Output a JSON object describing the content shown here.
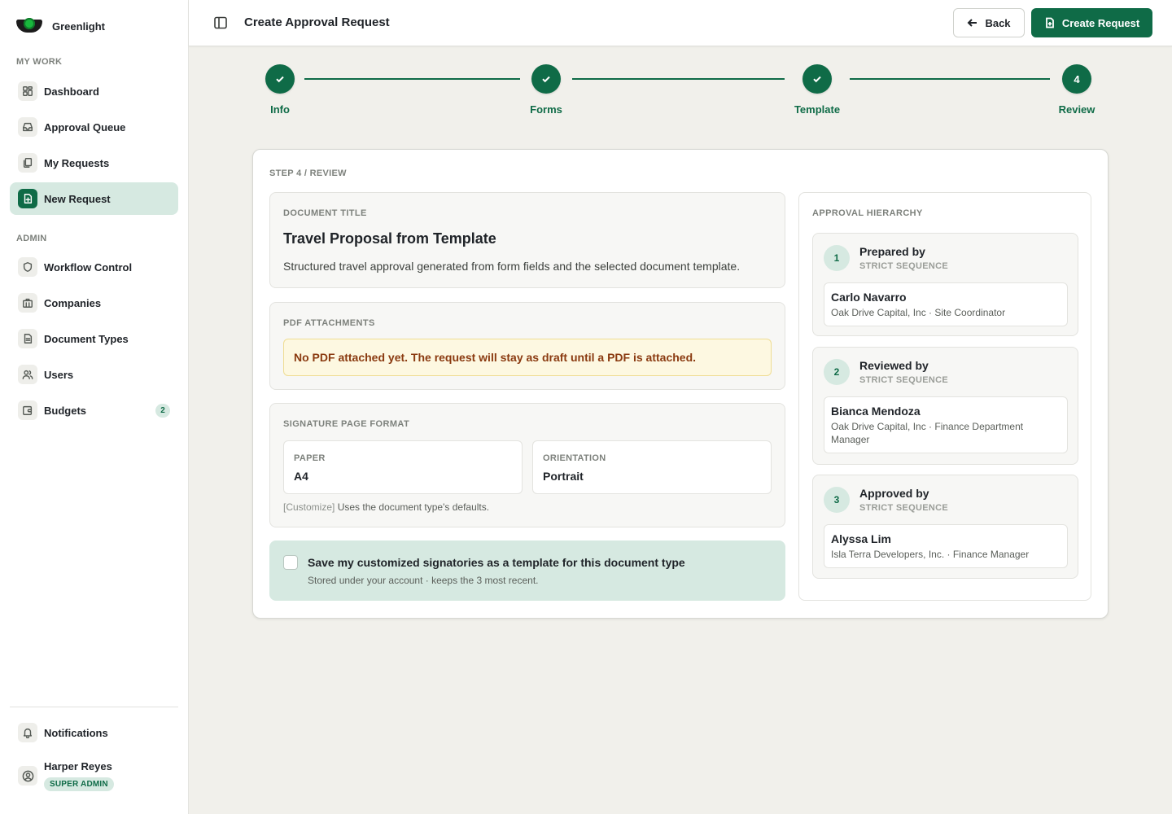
{
  "app": {
    "name": "Greenlight"
  },
  "sidebar": {
    "sections": [
      {
        "label": "MY WORK"
      },
      {
        "label": "ADMIN"
      }
    ],
    "my_work": [
      {
        "label": "Dashboard",
        "icon": "grid-icon"
      },
      {
        "label": "Approval Queue",
        "icon": "inbox-icon"
      },
      {
        "label": "My Requests",
        "icon": "files-icon"
      },
      {
        "label": "New Request",
        "icon": "file-plus-icon",
        "active": true
      }
    ],
    "admin": [
      {
        "label": "Workflow Control",
        "icon": "shield-icon"
      },
      {
        "label": "Companies",
        "icon": "building-icon"
      },
      {
        "label": "Document Types",
        "icon": "document-icon"
      },
      {
        "label": "Users",
        "icon": "users-icon"
      },
      {
        "label": "Budgets",
        "icon": "wallet-icon",
        "badge": "2"
      }
    ],
    "notifications": {
      "label": "Notifications",
      "icon": "bell-icon"
    },
    "user": {
      "name": "Harper Reyes",
      "role": "SUPER ADMIN"
    }
  },
  "header": {
    "title": "Create Approval Request",
    "back_label": "Back",
    "create_label": "Create Request"
  },
  "stepper": {
    "steps": [
      {
        "label": "Info",
        "status": "complete"
      },
      {
        "label": "Forms",
        "status": "complete"
      },
      {
        "label": "Template",
        "status": "complete"
      },
      {
        "label": "Review",
        "status": "current",
        "number": "4"
      }
    ]
  },
  "review": {
    "caption": "STEP 4 / REVIEW",
    "document": {
      "label": "DOCUMENT TITLE",
      "title": "Travel Proposal from Template",
      "description": "Structured travel approval generated from form fields and the selected document template."
    },
    "attachments": {
      "label": "PDF ATTACHMENTS",
      "alert": "No PDF attached yet. The request will stay as draft until a PDF is attached."
    },
    "signature_format": {
      "label": "SIGNATURE PAGE FORMAT",
      "paper_label": "PAPER",
      "paper_value": "A4",
      "orientation_label": "ORIENTATION",
      "orientation_value": "Portrait",
      "customize_label": "[Customize]",
      "note": "Uses the document type's defaults."
    },
    "save_template": {
      "checked": false,
      "title": "Save my customized signatories as a template for this document type",
      "subtitle": "Stored under your account · keeps the 3 most recent."
    },
    "hierarchy": {
      "label": "APPROVAL HIERARCHY",
      "levels": [
        {
          "number": "1",
          "title": "Prepared by",
          "mode": "STRICT SEQUENCE",
          "name": "Carlo Navarro",
          "meta": "Oak Drive Capital, Inc · Site Coordinator"
        },
        {
          "number": "2",
          "title": "Reviewed by",
          "mode": "STRICT SEQUENCE",
          "name": "Bianca Mendoza",
          "meta": "Oak Drive Capital, Inc · Finance Department Manager"
        },
        {
          "number": "3",
          "title": "Approved by",
          "mode": "STRICT SEQUENCE",
          "name": "Alyssa Lim",
          "meta": "Isla Terra Developers, Inc. · Finance Manager"
        }
      ]
    }
  },
  "colors": {
    "brand": "#0f6b47",
    "brand_light": "#d6e9e1",
    "background": "#f1f0eb",
    "warning_text": "#8a3a10",
    "warning_bg": "#fdf8e1"
  }
}
